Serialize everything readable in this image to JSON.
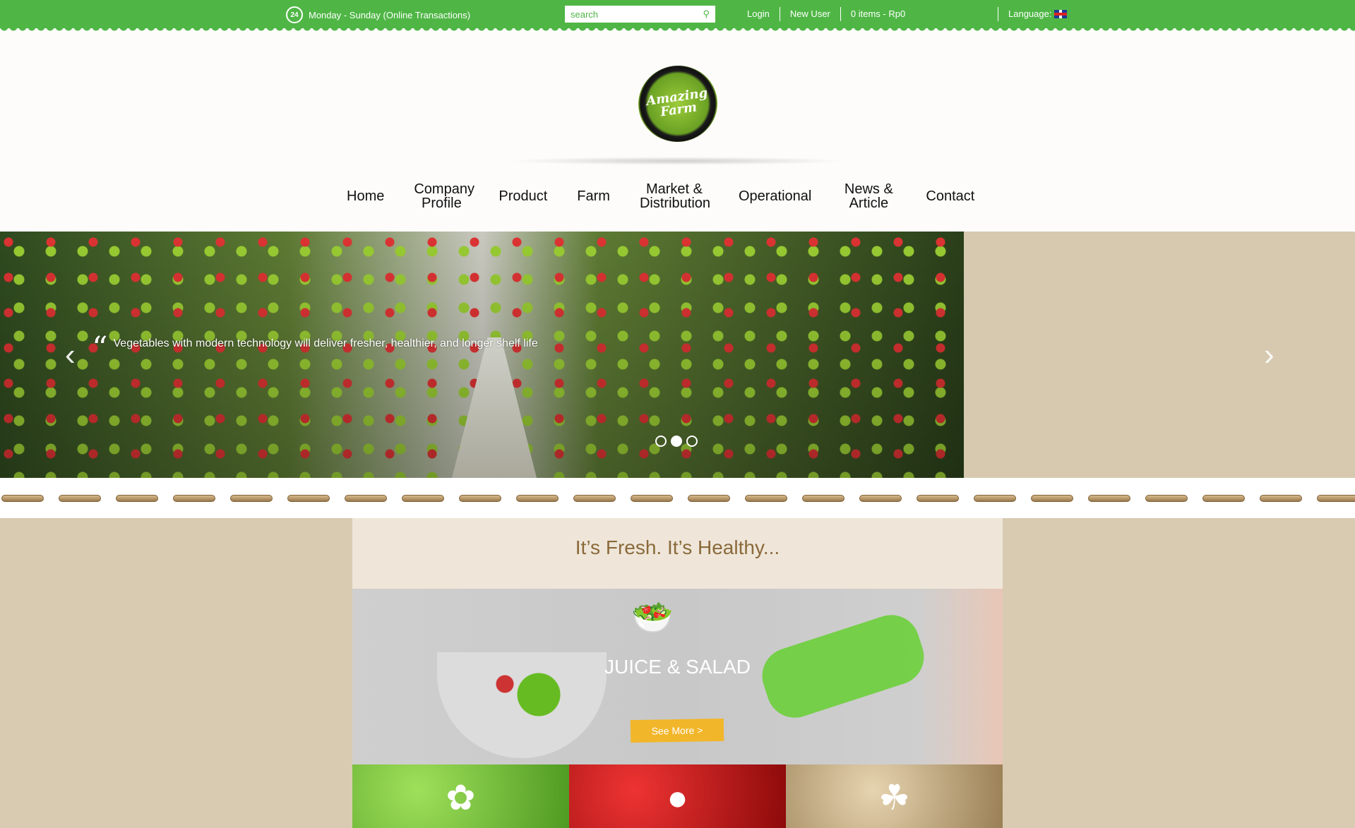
{
  "topbar": {
    "hours": "Monday - Sunday (Online Transactions)",
    "clock_label": "24",
    "search_placeholder": "search",
    "login": "Login",
    "new_user": "New User",
    "cart": "0 items - Rp0",
    "language": "Language:"
  },
  "logo": {
    "text": "Amazing Farm"
  },
  "nav": [
    "Home",
    "Company Profile",
    "Product",
    "Farm",
    "Market & Distribution",
    "Operational",
    "News & Article",
    "Contact"
  ],
  "slider": {
    "caption": "Vegetables with modern technology will deliver fresher, healthier, and longer shelf life",
    "quote_mark": "“",
    "prev": "‹",
    "next": "›",
    "active_dot": 2,
    "dot_count": 3
  },
  "content": {
    "tagline": "It’s Fresh. It’s Healthy...",
    "banner_title": "JUICE & SALAD",
    "see_more": "See More >",
    "banner_icon": "salad-juice-icon",
    "tiles": [
      {
        "icon": "leaf-icon"
      },
      {
        "icon": "tomato-icon"
      },
      {
        "icon": "sprout-hand-icon"
      }
    ]
  },
  "colors": {
    "brand_green": "#4fb645",
    "button_yellow": "#f2b62a",
    "tagline_brown": "#8a6a3b"
  }
}
